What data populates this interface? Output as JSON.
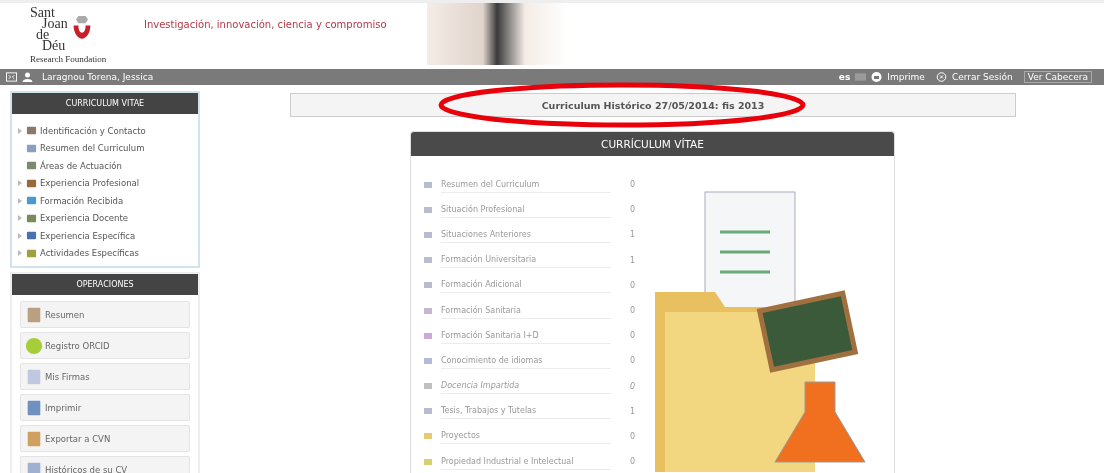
{
  "header": {
    "logo_lines": [
      "Sant",
      "Joan",
      "de",
      "Déu"
    ],
    "logo_subtitle": "Research Foundation",
    "tagline": "Investigación, innovación, ciencia y compromiso"
  },
  "user_bar": {
    "user": "Laragnou Torena, Jessica",
    "language": "es",
    "links": [
      "Imprime",
      "Cerrar Sesión",
      "Ver Cabecera"
    ]
  },
  "sidebar": {
    "cv_title": "CURRICULUM VITAE",
    "cv_items": [
      {
        "label": "Identificación y Contacto",
        "expandable": true
      },
      {
        "label": "Resumen del Curriculum",
        "expandable": false
      },
      {
        "label": "Áreas de Actuación",
        "expandable": false
      },
      {
        "label": "Experiencia Profesional",
        "expandable": true
      },
      {
        "label": "Formación Recibida",
        "expandable": true
      },
      {
        "label": "Experiencia Docente",
        "expandable": true
      },
      {
        "label": "Experiencia Específica",
        "expandable": true
      },
      {
        "label": "Actividades Específicas",
        "expandable": true
      }
    ],
    "ops_title": "OPERACIONES",
    "operations": [
      "Resumen",
      "Registro ORCID",
      "Mis Firmas",
      "Imprimir",
      "Exportar a CVN",
      "Históricos de su CV"
    ]
  },
  "page_title": "Curriculum Histórico 27/05/2014: fis 2013",
  "card": {
    "title": "CURRÍCULUM VÍTAE",
    "rows": [
      {
        "label": "Resumen del Curriculum",
        "count": "0",
        "color": "#b8bccc",
        "italic": false
      },
      {
        "label": "Situación Profesional",
        "count": "0",
        "color": "#b8bccc",
        "italic": false
      },
      {
        "label": "Situaciones Anteriores",
        "count": "1",
        "color": "#b8bccc",
        "italic": false
      },
      {
        "label": "Formación Universitaria",
        "count": "1",
        "color": "#b8bccc",
        "italic": false
      },
      {
        "label": "Formación Adicional",
        "count": "0",
        "color": "#b8bccc",
        "italic": false
      },
      {
        "label": "Formación Sanitaria",
        "count": "0",
        "color": "#c4b8d0",
        "italic": false
      },
      {
        "label": "Formación Sanitaria I+D",
        "count": "0",
        "color": "#cca8d8",
        "italic": false
      },
      {
        "label": "Conocimiento de idiomas",
        "count": "0",
        "color": "#b8b8dc",
        "italic": false
      },
      {
        "label": "Docencia Impartida",
        "count": "0",
        "color": "#c0c0c0",
        "italic": true
      },
      {
        "label": "Tesis, Trabajos y Tutelas",
        "count": "1",
        "color": "#b8bccc",
        "italic": false
      },
      {
        "label": "Proyectos",
        "count": "0",
        "color": "#e8c870",
        "italic": false
      },
      {
        "label": "Propiedad Industrial e Intelectual",
        "count": "0",
        "color": "#d8d070",
        "italic": false
      }
    ]
  }
}
